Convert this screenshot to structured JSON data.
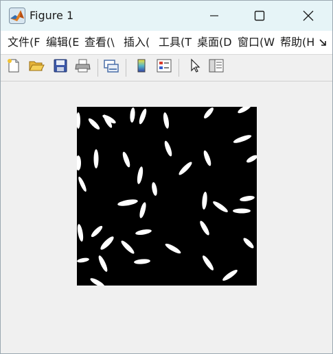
{
  "window": {
    "title": "Figure 1",
    "app_icon": "matlab-icon"
  },
  "title_buttons": {
    "minimize_icon": "minimize-icon",
    "maximize_icon": "maximize-icon",
    "close_icon": "close-icon"
  },
  "menu": {
    "items": [
      {
        "label": "文件(F"
      },
      {
        "label": "编辑(E"
      },
      {
        "label": "查看(\\"
      },
      {
        "label": "插入("
      },
      {
        "label": "工具(T"
      },
      {
        "label": "桌面(D"
      },
      {
        "label": "窗口(W"
      },
      {
        "label": "帮助(H"
      }
    ],
    "overflow_icon": "chevron-overflow-icon"
  },
  "toolbar": {
    "icons": [
      "new-figure-icon",
      "open-file-icon",
      "save-icon",
      "print-icon",
      "link-plot-icon",
      "insert-colorbar-icon",
      "insert-legend-icon",
      "edit-plot-cursor-icon",
      "property-inspector-icon"
    ]
  },
  "image": {
    "description_colors": {
      "background": "#000000",
      "foreground": "#ffffff"
    }
  }
}
